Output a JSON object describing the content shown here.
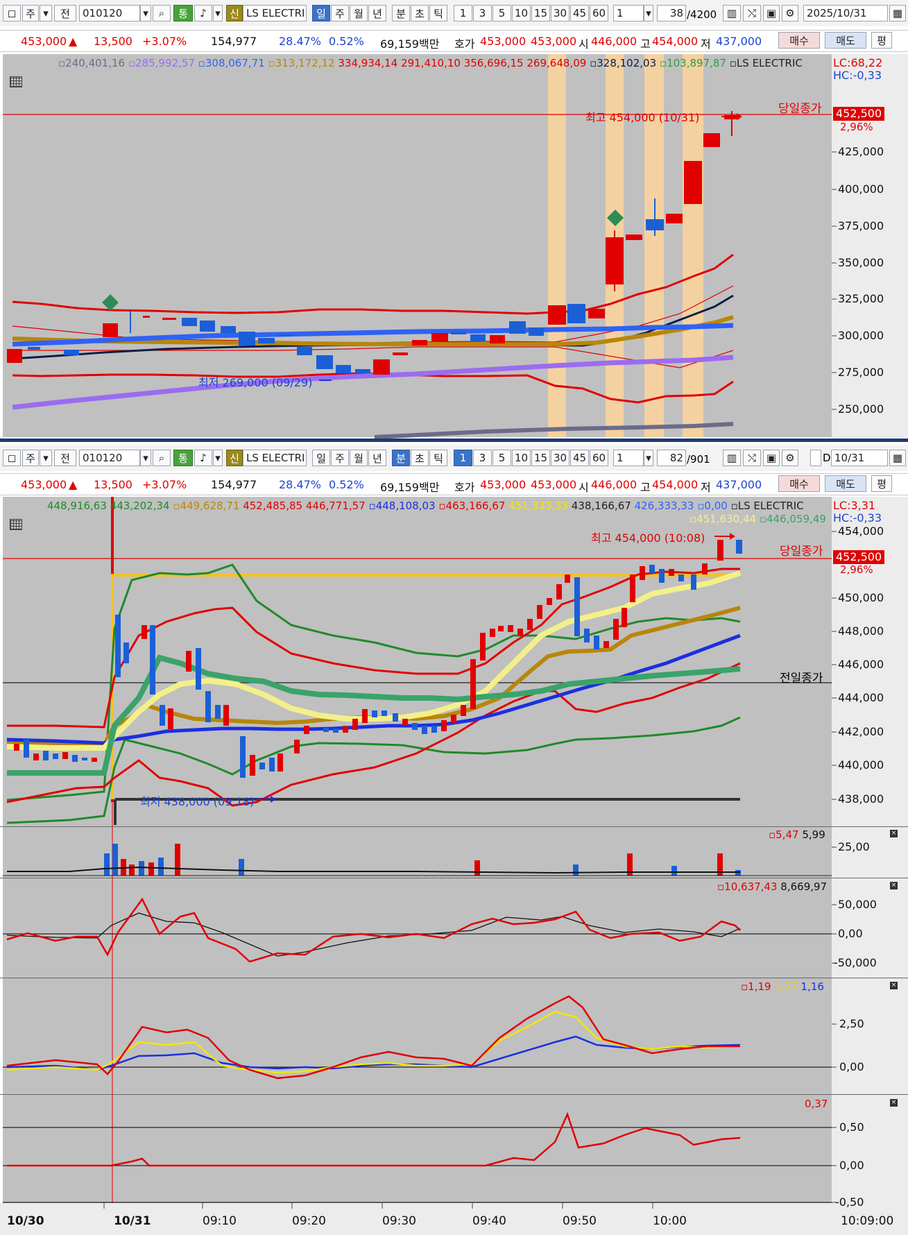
{
  "daily": {
    "toolbar": {
      "period_type": "주",
      "prev_label": "전",
      "code": "010120",
      "tong_label": "통",
      "shin_label": "신",
      "stock_name": "LS ELECTRI",
      "periods": [
        "일",
        "주",
        "월",
        "년",
        "분",
        "초",
        "틱"
      ],
      "active_period": "일",
      "intervals": [
        "1",
        "3",
        "5",
        "10",
        "15",
        "30",
        "45",
        "60"
      ],
      "multiplier": "1",
      "count_current": "38",
      "count_total": "/4200",
      "date": "2025/10/31"
    },
    "info": {
      "price": "453,000",
      "change_symbol": "▲",
      "change": "13,500",
      "change_pct": "+3.07%",
      "volume": "154,977",
      "ratio1": "28.47%",
      "ratio2": "0.52%",
      "trade_value": "69,159백만",
      "hoga_label": "호가",
      "ask": "453,000",
      "bid": "453,000",
      "open_label": "시",
      "open": "446,000",
      "high_label": "고",
      "high": "454,000",
      "low_label": "저",
      "low": "437,000",
      "buy_label": "매수",
      "sell_label": "매도",
      "avg_label": "평"
    },
    "legend": [
      {
        "text": "240,401,16",
        "color": "#6b6b8a"
      },
      {
        "text": "285,992,57",
        "color": "#9b6cf0"
      },
      {
        "text": "308,067,71",
        "color": "#2f62f5"
      },
      {
        "text": "313,172,12",
        "color": "#b8860b"
      },
      {
        "text": "334,934,14",
        "color": "#e00000"
      },
      {
        "text": "291,410,10",
        "color": "#e00000"
      },
      {
        "text": "356,696,15",
        "color": "#e00000"
      },
      {
        "text": "269,648,09",
        "color": "#e00000"
      },
      {
        "text": "328,102,03",
        "color": "#0b1e44"
      },
      {
        "text": "103,897,87",
        "color": "#2aa040"
      },
      {
        "text": "LS ELECTRIC",
        "color": "#222"
      }
    ],
    "lc": "LC:68,22",
    "hc": "HC:-0,33",
    "close_label": "당일종가",
    "current_price": "452,500",
    "current_pct": "2,96%",
    "max_label": "최고 454,000 (10/31)",
    "min_label": "최저 269,000 (09/29)",
    "yaxis": [
      "425,000",
      "400,000",
      "375,000",
      "350,000",
      "325,000",
      "300,000",
      "275,000",
      "250,000"
    ]
  },
  "minute": {
    "toolbar": {
      "period_type": "주",
      "prev_label": "전",
      "code": "010120",
      "tong_label": "통",
      "shin_label": "신",
      "stock_name": "LS ELECTRI",
      "periods": [
        "일",
        "주",
        "월",
        "년",
        "분",
        "초",
        "틱"
      ],
      "active_period": "분",
      "intervals": [
        "1",
        "3",
        "5",
        "10",
        "15",
        "30",
        "45",
        "60"
      ],
      "active_interval": "1",
      "multiplier": "1",
      "count_current": "82",
      "count_total": "/901",
      "d_label": "D",
      "date": "10/31"
    },
    "info": {
      "price": "453,000",
      "change_symbol": "▲",
      "change": "13,500",
      "change_pct": "+3.07%",
      "volume": "154,977",
      "ratio1": "28.47%",
      "ratio2": "0.52%",
      "trade_value": "69,159백만",
      "hoga_label": "호가",
      "ask": "453,000",
      "bid": "453,000",
      "open_label": "시",
      "open": "446,000",
      "high_label": "고",
      "high": "454,000",
      "low_label": "저",
      "low": "437,000",
      "buy_label": "매수",
      "sell_label": "매도",
      "avg_label": "평"
    },
    "legend": [
      {
        "text": "448,916,63",
        "color": "#1f8a2a"
      },
      {
        "text": "443,202,34",
        "color": "#1f8a2a"
      },
      {
        "text": "449,628,71",
        "color": "#b8860b"
      },
      {
        "text": "452,485,85",
        "color": "#e00000"
      },
      {
        "text": "446,771,57",
        "color": "#e00000"
      },
      {
        "text": "448,108,03",
        "color": "#1b2fe0"
      },
      {
        "text": "463,166,67",
        "color": "#e00000"
      },
      {
        "text": "451,333,33",
        "color": "#f3e600"
      },
      {
        "text": "438,166,67",
        "color": "#222"
      },
      {
        "text": "426,333,33",
        "color": "#2f62f5"
      },
      {
        "text": "0,00",
        "color": "#2f62f5"
      },
      {
        "text": "LS ELECTRIC",
        "color": "#222"
      }
    ],
    "legend2": [
      {
        "text": "451,630,44",
        "color": "#f3f08a"
      },
      {
        "text": "446,059,49",
        "color": "#3aa36a"
      }
    ],
    "lc": "LC:3,31",
    "hc": "HC:-0,33",
    "close_label": "당일종가",
    "prev_close_label": "전일종가",
    "current_price": "452,500",
    "current_pct": "2,96%",
    "max_label": "최고 454,000 (10:08)",
    "min_label": "최저 438,000 (09:18)",
    "yaxis": [
      "454,000",
      "450,000",
      "448,000",
      "446,000",
      "444,000",
      "442,000",
      "440,000",
      "438,000"
    ],
    "volume_panel": {
      "legend": [
        {
          "text": "5,47",
          "color": "#e00000"
        },
        {
          "text": "5,99",
          "color": "#111"
        }
      ],
      "yaxis": [
        "25,00"
      ]
    },
    "macd_panel": {
      "legend": [
        {
          "text": "10,637,43",
          "color": "#e00000"
        },
        {
          "text": "8,669,97",
          "color": "#111"
        }
      ],
      "yaxis": [
        "50,000",
        "0,00",
        "-50,000"
      ]
    },
    "osc_panel": {
      "legend": [
        {
          "text": "1,19",
          "color": "#e00000"
        },
        {
          "text": "1,27",
          "color": "#e6d200"
        },
        {
          "text": "1,16",
          "color": "#1b2fe0"
        }
      ],
      "yaxis": [
        "2,50",
        "0,00"
      ]
    },
    "last_panel": {
      "legend": [
        {
          "text": "0,37",
          "color": "#e00000"
        }
      ],
      "yaxis": [
        "0,50",
        "0,00",
        "-0,50"
      ]
    },
    "xaxis": [
      "10/30",
      "10/31",
      "09:10",
      "09:20",
      "09:30",
      "09:40",
      "09:50",
      "10:00",
      "10:09:00"
    ]
  }
}
